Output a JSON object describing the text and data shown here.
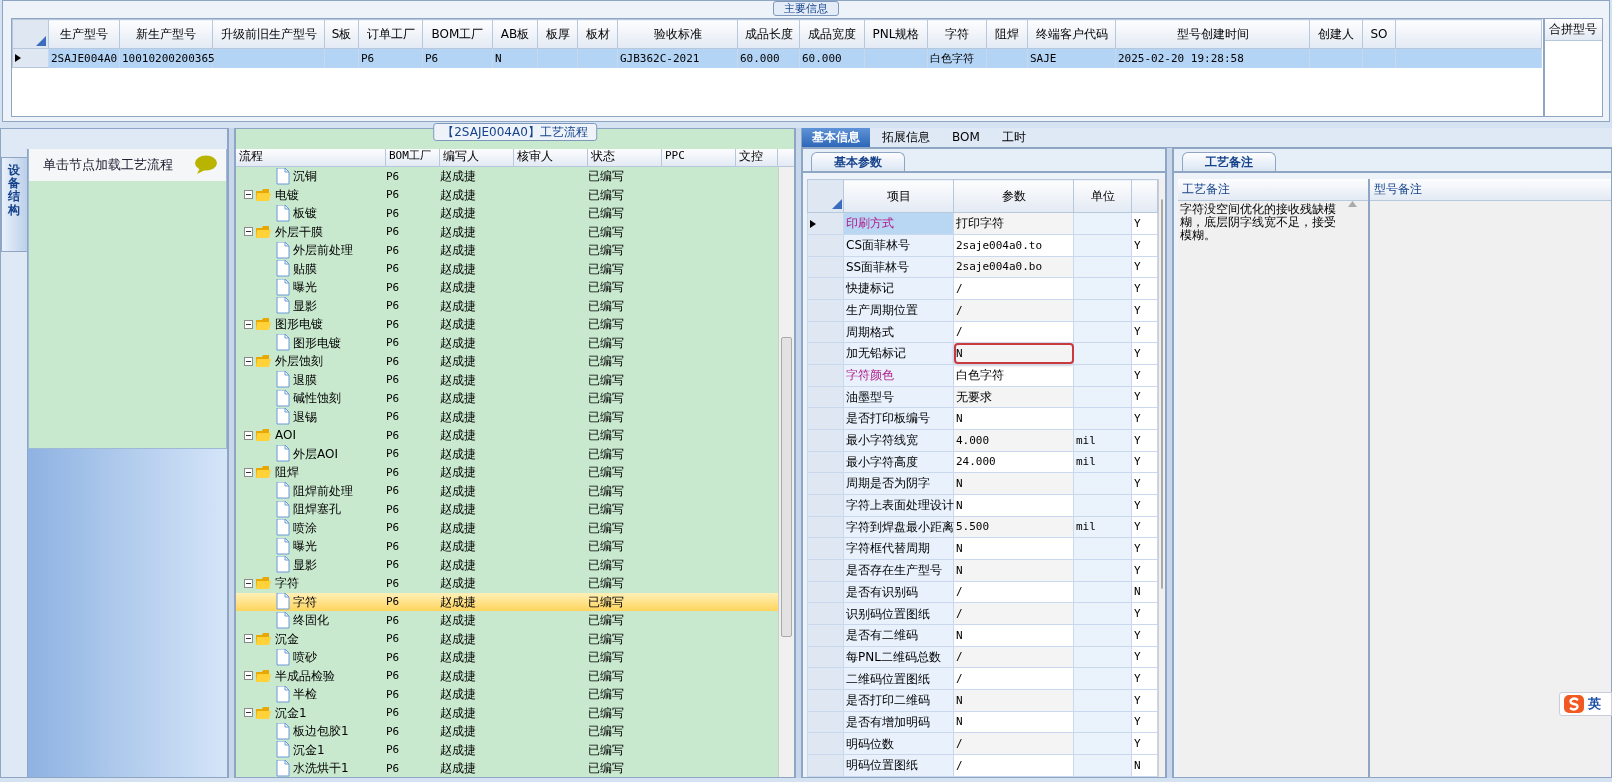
{
  "main_info": {
    "title": "主要信息",
    "columns": [
      "生产型号",
      "新生产型号",
      "升级前旧生产型号",
      "S板",
      "订单工厂",
      "BOM工厂",
      "AB板",
      "板厚",
      "板材",
      "验收标准",
      "成品长度",
      "成品宽度",
      "PNL规格",
      "字符",
      "阻焊",
      "终端客户代码",
      "型号创建时间",
      "创建人",
      "SO"
    ],
    "rows": [
      {
        "selected": true,
        "cells": [
          "2SAJE004A0",
          "10010200200365",
          null,
          null,
          "P6",
          "P6",
          "N",
          null,
          null,
          "GJB362C-2021",
          "60.000",
          "60.000",
          null,
          "白色字符",
          null,
          "SAJE",
          "2025-02-20 19:28:58",
          null,
          null
        ]
      }
    ]
  },
  "merge_panel": {
    "title": "合拼型号"
  },
  "side_panel": {
    "vertical_tab": "设备结构",
    "hint": "单击节点加载工艺流程"
  },
  "process_flow": {
    "title": "【2SAJE004A0】工艺流程",
    "columns": [
      "流程",
      "BOM工厂",
      "编写人",
      "核审人",
      "状态",
      "PPC",
      "文控"
    ],
    "tree": [
      {
        "children": [
          {
            "label": "沉铜",
            "bom": "P6",
            "writer": "赵成捷",
            "status": "已编写",
            "selected": false
          }
        ]
      },
      {
        "label": "电镀",
        "bom": "P6",
        "writer": "赵成捷",
        "status": "已编写",
        "selected": false,
        "children": [
          {
            "label": "板镀",
            "bom": "P6",
            "writer": "赵成捷",
            "status": "已编写",
            "selected": false
          }
        ]
      },
      {
        "label": "外层干膜",
        "bom": "P6",
        "writer": "赵成捷",
        "status": "已编写",
        "selected": false,
        "children": [
          {
            "label": "外层前处理",
            "bom": "P6",
            "writer": "赵成捷",
            "status": "已编写",
            "selected": false
          },
          {
            "label": "贴膜",
            "bom": "P6",
            "writer": "赵成捷",
            "status": "已编写",
            "selected": false
          },
          {
            "label": "曝光",
            "bom": "P6",
            "writer": "赵成捷",
            "status": "已编写",
            "selected": false
          },
          {
            "label": "显影",
            "bom": "P6",
            "writer": "赵成捷",
            "status": "已编写",
            "selected": false
          }
        ]
      },
      {
        "label": "图形电镀",
        "bom": "P6",
        "writer": "赵成捷",
        "status": "已编写",
        "selected": false,
        "children": [
          {
            "label": "图形电镀",
            "bom": "P6",
            "writer": "赵成捷",
            "status": "已编写",
            "selected": false
          }
        ]
      },
      {
        "label": "外层蚀刻",
        "bom": "P6",
        "writer": "赵成捷",
        "status": "已编写",
        "selected": false,
        "children": [
          {
            "label": "退膜",
            "bom": "P6",
            "writer": "赵成捷",
            "status": "已编写",
            "selected": false
          },
          {
            "label": "碱性蚀刻",
            "bom": "P6",
            "writer": "赵成捷",
            "status": "已编写",
            "selected": false
          },
          {
            "label": "退锡",
            "bom": "P6",
            "writer": "赵成捷",
            "status": "已编写",
            "selected": false
          }
        ]
      },
      {
        "label": "AOI",
        "bom": "P6",
        "writer": "赵成捷",
        "status": "已编写",
        "selected": false,
        "children": [
          {
            "label": "外层AOI",
            "bom": "P6",
            "writer": "赵成捷",
            "status": "已编写",
            "selected": false
          }
        ]
      },
      {
        "label": "阻焊",
        "bom": "P6",
        "writer": "赵成捷",
        "status": "已编写",
        "selected": false,
        "children": [
          {
            "label": "阻焊前处理",
            "bom": "P6",
            "writer": "赵成捷",
            "status": "已编写",
            "selected": false
          },
          {
            "label": "阻焊塞孔",
            "bom": "P6",
            "writer": "赵成捷",
            "status": "已编写",
            "selected": false
          },
          {
            "label": "喷涂",
            "bom": "P6",
            "writer": "赵成捷",
            "status": "已编写",
            "selected": false
          },
          {
            "label": "曝光",
            "bom": "P6",
            "writer": "赵成捷",
            "status": "已编写",
            "selected": false
          },
          {
            "label": "显影",
            "bom": "P6",
            "writer": "赵成捷",
            "status": "已编写",
            "selected": false
          }
        ]
      },
      {
        "label": "字符",
        "bom": "P6",
        "writer": "赵成捷",
        "status": "已编写",
        "selected": false,
        "children": [
          {
            "label": "字符",
            "bom": "P6",
            "writer": "赵成捷",
            "status": "已编写",
            "selected": true
          },
          {
            "label": "终固化",
            "bom": "P6",
            "writer": "赵成捷",
            "status": "已编写",
            "selected": false
          }
        ]
      },
      {
        "label": "沉金",
        "bom": "P6",
        "writer": "赵成捷",
        "status": "已编写",
        "selected": false,
        "children": [
          {
            "label": "喷砂",
            "bom": "P6",
            "writer": "赵成捷",
            "status": "已编写",
            "selected": false
          }
        ]
      },
      {
        "label": "半成品检验",
        "bom": "P6",
        "writer": "赵成捷",
        "status": "已编写",
        "selected": false,
        "children": [
          {
            "label": "半检",
            "bom": "P6",
            "writer": "赵成捷",
            "status": "已编写",
            "selected": false
          }
        ]
      },
      {
        "label": "沉金1",
        "bom": "P6",
        "writer": "赵成捷",
        "status": "已编写",
        "selected": false,
        "children": [
          {
            "label": "板边包胶1",
            "bom": "P6",
            "writer": "赵成捷",
            "status": "已编写",
            "selected": false
          },
          {
            "label": "沉金1",
            "bom": "P6",
            "writer": "赵成捷",
            "status": "已编写",
            "selected": false
          },
          {
            "label": "水洗烘干1",
            "bom": "P6",
            "writer": "赵成捷",
            "status": "已编写",
            "selected": false
          }
        ]
      }
    ]
  },
  "detail_tabs": [
    {
      "label": "基本信息",
      "selected": true
    },
    {
      "label": "拓展信息",
      "selected": false
    },
    {
      "label": "BOM",
      "selected": false
    },
    {
      "label": "工时",
      "selected": false
    }
  ],
  "params": {
    "tab": "基本参数",
    "columns": [
      "项目",
      "参数",
      "单位"
    ],
    "rows": [
      {
        "item": "印刷方式",
        "value": "打印字符",
        "flag": "Y",
        "highlighted": true,
        "annotated": false,
        "selected": true
      },
      {
        "item": "CS面菲林号",
        "value": "2saje004a0.to",
        "flag": "Y",
        "highlighted": false,
        "annotated": false,
        "selected": false
      },
      {
        "item": "SS面菲林号",
        "value": "2saje004a0.bo",
        "flag": "Y",
        "highlighted": false,
        "annotated": false,
        "selected": false
      },
      {
        "item": "快捷标记",
        "value": "/",
        "flag": "Y",
        "highlighted": false,
        "annotated": false,
        "selected": false
      },
      {
        "item": "生产周期位置",
        "value": "/",
        "flag": "Y",
        "highlighted": false,
        "annotated": false,
        "selected": false
      },
      {
        "item": "周期格式",
        "value": "/",
        "flag": "Y",
        "highlighted": false,
        "annotated": false,
        "selected": false
      },
      {
        "item": "加无铅标记",
        "value": "N",
        "flag": "Y",
        "highlighted": false,
        "annotated": true,
        "selected": false
      },
      {
        "item": "字符颜色",
        "value": "白色字符",
        "flag": "Y",
        "highlighted": true,
        "annotated": false,
        "selected": false
      },
      {
        "item": "油墨型号",
        "value": "无要求",
        "flag": "Y",
        "highlighted": false,
        "annotated": false,
        "selected": false
      },
      {
        "item": "是否打印板编号",
        "value": "N",
        "flag": "Y",
        "highlighted": false,
        "annotated": false,
        "selected": false
      },
      {
        "item": "最小字符线宽",
        "value": "4.000",
        "unit": "mil",
        "flag": "Y",
        "highlighted": false,
        "annotated": false,
        "selected": false
      },
      {
        "item": "最小字符高度",
        "value": "24.000",
        "unit": "mil",
        "flag": "Y",
        "highlighted": false,
        "annotated": false,
        "selected": false
      },
      {
        "item": "周期是否为阴字",
        "value": "N",
        "flag": "Y",
        "highlighted": false,
        "annotated": false,
        "selected": false
      },
      {
        "item": "字符上表面处理设计",
        "value": "N",
        "flag": "Y",
        "highlighted": false,
        "annotated": false,
        "selected": false
      },
      {
        "item": "字符到焊盘最小距离",
        "value": "5.500",
        "unit": "mil",
        "flag": "Y",
        "highlighted": false,
        "annotated": false,
        "selected": false
      },
      {
        "item": "字符框代替周期",
        "value": "N",
        "flag": "Y",
        "highlighted": false,
        "annotated": false,
        "selected": false
      },
      {
        "item": "是否存在生产型号",
        "value": "N",
        "flag": "Y",
        "highlighted": false,
        "annotated": false,
        "selected": false
      },
      {
        "item": "是否有识别码",
        "value": "/",
        "flag": "N",
        "highlighted": false,
        "annotated": false,
        "selected": false
      },
      {
        "item": "识别码位置图纸",
        "value": "/",
        "flag": "Y",
        "highlighted": false,
        "annotated": false,
        "selected": false
      },
      {
        "item": "是否有二维码",
        "value": "N",
        "flag": "Y",
        "highlighted": false,
        "annotated": false,
        "selected": false
      },
      {
        "item": "每PNL二维码总数",
        "value": "/",
        "flag": "Y",
        "highlighted": false,
        "annotated": false,
        "selected": false
      },
      {
        "item": "二维码位置图纸",
        "value": "/",
        "flag": "Y",
        "highlighted": false,
        "annotated": false,
        "selected": false
      },
      {
        "item": "是否打印二维码",
        "value": "N",
        "flag": "Y",
        "highlighted": false,
        "annotated": false,
        "selected": false
      },
      {
        "item": "是否有增加明码",
        "value": "N",
        "flag": "Y",
        "highlighted": false,
        "annotated": false,
        "selected": false
      },
      {
        "item": "明码位数",
        "value": "/",
        "flag": "Y",
        "highlighted": false,
        "annotated": false,
        "selected": false
      },
      {
        "item": "明码位置图纸",
        "value": "/",
        "flag": "N",
        "highlighted": false,
        "annotated": false,
        "selected": false
      }
    ]
  },
  "remarks": {
    "tab": "工艺备注",
    "columns": [
      "工艺备注",
      "型号备注"
    ],
    "process_note": "字符没空间优化的接收残缺模糊，底层阴字线宽不足，接受模糊。"
  },
  "ime": {
    "label": "英"
  }
}
